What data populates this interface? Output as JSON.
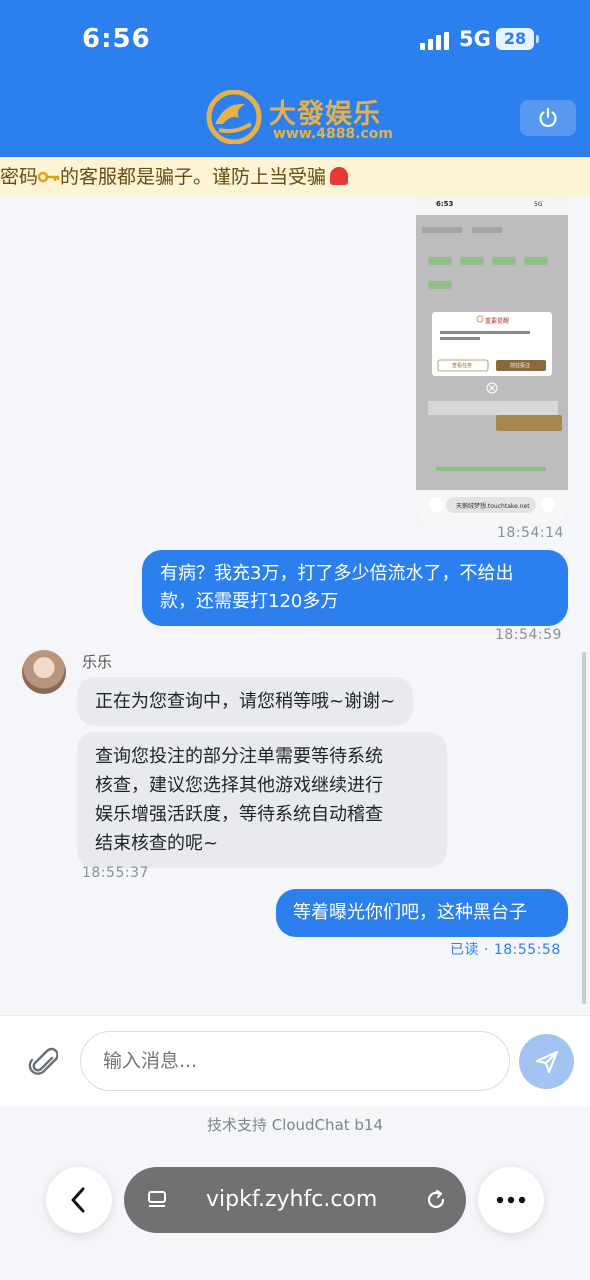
{
  "status_bar": {
    "time": "6:56",
    "network": "5G",
    "battery": "28"
  },
  "header": {
    "brand_name": "大發娱乐",
    "brand_url": "www.4888.com"
  },
  "notice": {
    "text_before": "密码",
    "text_after": "的客服都是骗子。谨防上当受骗"
  },
  "messages": [
    {
      "type": "image",
      "time": "18:54:14"
    },
    {
      "type": "outgoing",
      "lines": [
        "有病？我充3万，打了多少倍流水了，不给出",
        "款，还需要打120多万"
      ],
      "time": "18:54:59"
    },
    {
      "type": "incoming",
      "sender": "乐乐",
      "text": "正在为您查询中，请您稍等哦~谢谢~"
    },
    {
      "type": "incoming",
      "lines": [
        "查询您投注的部分注单需要等待系统",
        "核查，建议您选择其他游戏继续进行",
        "娱乐增强活跃度，等待系统自动稽查",
        "结束核查的呢~"
      ],
      "time": "18:55:37"
    },
    {
      "type": "outgoing",
      "text": "等着曝光你们吧，这种黑台子",
      "read_label": "已读 · ",
      "time": "18:55:58"
    }
  ],
  "embedded_screenshot": {
    "time": "6:53",
    "network": "5G",
    "dialog_title": "重要提醒",
    "dialog_button_left": "查看任务",
    "dialog_button_right": "前往投注",
    "url": "天鹅绒梦想.touchtake.net"
  },
  "input": {
    "placeholder": "输入消息..."
  },
  "footer": {
    "credit": "技术支持 CloudChat b14"
  },
  "browser": {
    "url": "vipkf.zyhfc.com"
  },
  "colors": {
    "primary": "#2b80ee",
    "brand_gold": "#e6b14a",
    "notice_bg": "#fdf4d6"
  }
}
